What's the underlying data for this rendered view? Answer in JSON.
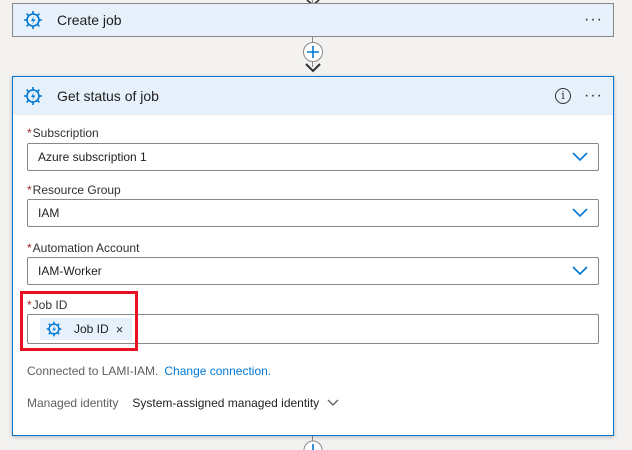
{
  "create_job_card": {
    "title": "Create job",
    "icon": "automation-gear-icon",
    "more": "···"
  },
  "add_step": {
    "icon": "plus-icon"
  },
  "get_status_card": {
    "title": "Get status of job",
    "icon": "automation-gear-icon",
    "info": "i",
    "more": "···",
    "required_mark": "*",
    "fields": {
      "subscription": {
        "label": "Subscription",
        "value": "Azure subscription 1"
      },
      "resource_group": {
        "label": "Resource Group",
        "value": "IAM"
      },
      "automation_account": {
        "label": "Automation Account",
        "value": "IAM-Worker"
      },
      "job_id": {
        "label": "Job ID",
        "token": "Job ID",
        "token_remove": "×"
      }
    },
    "connection": {
      "text": "Connected to LAMI-IAM.",
      "link": "Change connection."
    },
    "managed_identity": {
      "label": "Managed identity",
      "value": "System-assigned managed identity"
    }
  },
  "colors": {
    "accent": "#0078d4",
    "highlight": "#e81123",
    "header_bg": "#e6f1fb",
    "required": "#a4262c"
  }
}
